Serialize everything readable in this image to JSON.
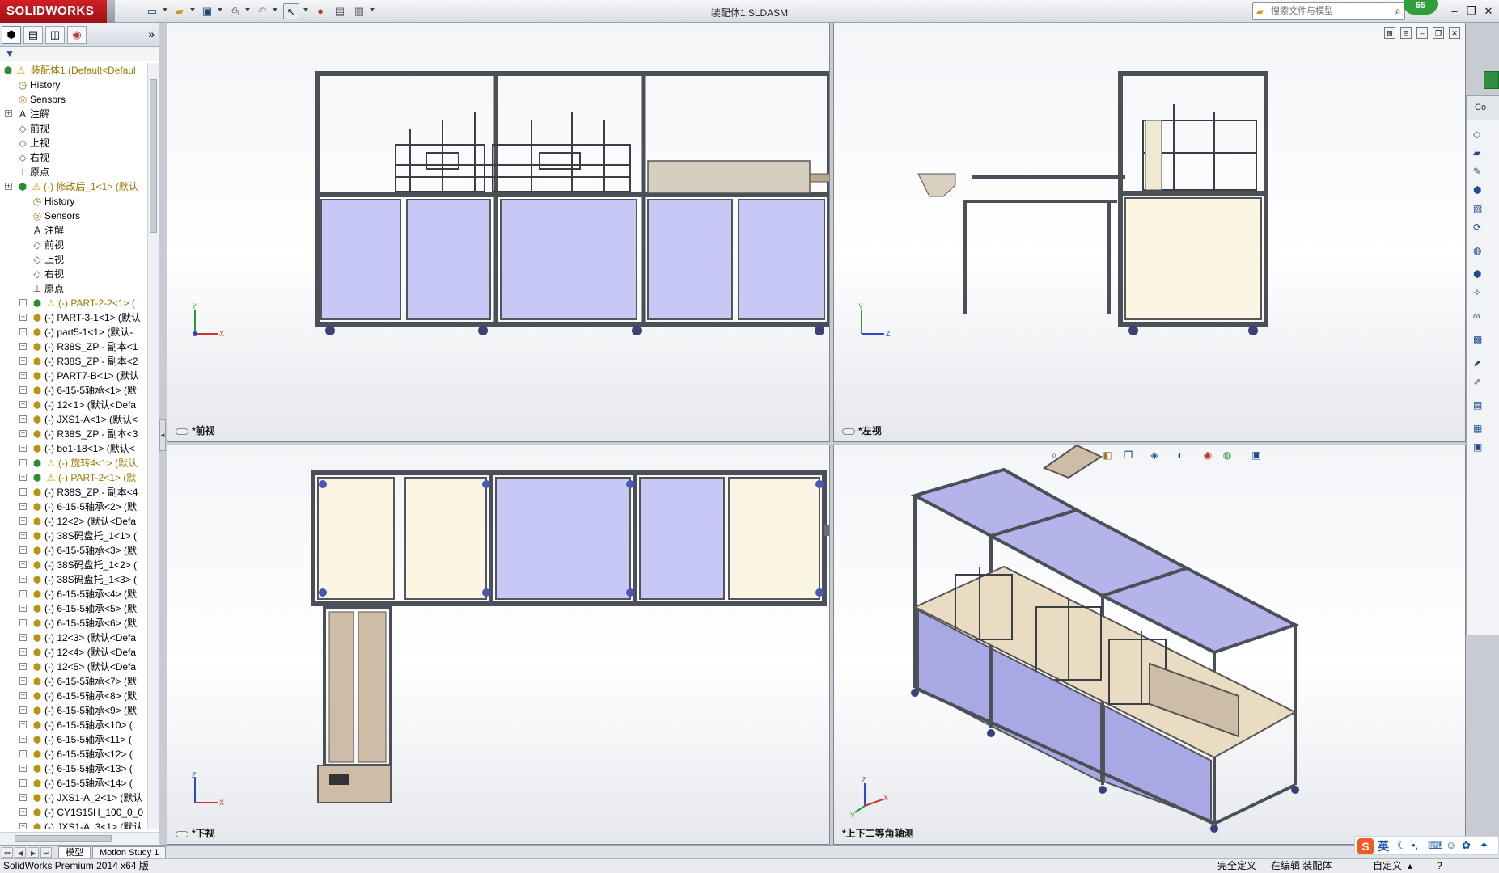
{
  "app": {
    "logo_text": "SOLIDWORKS",
    "document_title": "装配体1.SLDASM",
    "search_placeholder": "搜索文件与模型",
    "badge_count": "65"
  },
  "feature_tree": {
    "root_label": "装配体1  (Default<Defaul",
    "items": [
      {
        "label": "History",
        "icon": "history-icon",
        "indent": 1
      },
      {
        "label": "Sensors",
        "icon": "sensors-icon",
        "indent": 1
      },
      {
        "label": "注解",
        "icon": "annotations-icon",
        "indent": 1,
        "expandable": true
      },
      {
        "label": "前视",
        "icon": "plane-icon",
        "indent": 1
      },
      {
        "label": "上视",
        "icon": "plane-icon",
        "indent": 1
      },
      {
        "label": "右视",
        "icon": "plane-icon",
        "indent": 1
      },
      {
        "label": "原点",
        "icon": "origin-icon",
        "indent": 1
      },
      {
        "label": "(-) 修改后_1<1> (默认",
        "icon": "subassembly-icon",
        "indent": 1,
        "expandable": true,
        "warning": true
      },
      {
        "label": "History",
        "icon": "history-icon",
        "indent": 2
      },
      {
        "label": "Sensors",
        "icon": "sensors-icon",
        "indent": 2
      },
      {
        "label": "注解",
        "icon": "annotations-icon",
        "indent": 2
      },
      {
        "label": "前视",
        "icon": "plane-icon",
        "indent": 2
      },
      {
        "label": "上视",
        "icon": "plane-icon",
        "indent": 2
      },
      {
        "label": "右视",
        "icon": "plane-icon",
        "indent": 2
      },
      {
        "label": "原点",
        "icon": "origin-icon",
        "indent": 2
      },
      {
        "label": "(-) PART-2-2<1> (",
        "icon": "subassembly-icon",
        "indent": 2,
        "expandable": true,
        "warning": true
      },
      {
        "label": "(-) PART-3-1<1> (默认",
        "icon": "part-icon",
        "indent": 2,
        "expandable": true
      },
      {
        "label": "(-) part5-1<1> (默认-",
        "icon": "part-icon",
        "indent": 2,
        "expandable": true
      },
      {
        "label": "(-) R38S_ZP - 副本<1",
        "icon": "part-icon",
        "indent": 2,
        "expandable": true
      },
      {
        "label": "(-) R38S_ZP - 副本<2",
        "icon": "part-icon",
        "indent": 2,
        "expandable": true
      },
      {
        "label": "(-) PART7-B<1> (默认",
        "icon": "part-icon",
        "indent": 2,
        "expandable": true
      },
      {
        "label": "(-) 6-15-5轴承<1> (默",
        "icon": "part-icon",
        "indent": 2,
        "expandable": true
      },
      {
        "label": "(-) 12<1> (默认<Defa",
        "icon": "part-icon",
        "indent": 2,
        "expandable": true
      },
      {
        "label": "(-) JXS1-A<1> (默认<",
        "icon": "part-icon",
        "indent": 2,
        "expandable": true
      },
      {
        "label": "(-) R38S_ZP - 副本<3",
        "icon": "part-icon",
        "indent": 2,
        "expandable": true
      },
      {
        "label": "(-) be1-18<1> (默认<",
        "icon": "part-icon",
        "indent": 2,
        "expandable": true
      },
      {
        "label": "(-) 旋转4<1> (默认",
        "icon": "subassembly-icon",
        "indent": 2,
        "expandable": true,
        "warning": true
      },
      {
        "label": "(-) PART-2<1> (默",
        "icon": "subassembly-icon",
        "indent": 2,
        "expandable": true,
        "warning": true
      },
      {
        "label": "(-) R38S_ZP - 副本<4",
        "icon": "part-icon",
        "indent": 2,
        "expandable": true
      },
      {
        "label": "(-) 6-15-5轴承<2> (默",
        "icon": "part-icon",
        "indent": 2,
        "expandable": true
      },
      {
        "label": "(-) 12<2> (默认<Defa",
        "icon": "part-icon",
        "indent": 2,
        "expandable": true
      },
      {
        "label": "(-) 38S码盘托_1<1> (",
        "icon": "part-icon",
        "indent": 2,
        "expandable": true
      },
      {
        "label": "(-) 6-15-5轴承<3> (默",
        "icon": "part-icon",
        "indent": 2,
        "expandable": true
      },
      {
        "label": "(-) 38S码盘托_1<2> (",
        "icon": "part-icon",
        "indent": 2,
        "expandable": true
      },
      {
        "label": "(-) 38S码盘托_1<3> (",
        "icon": "part-icon",
        "indent": 2,
        "expandable": true
      },
      {
        "label": "(-) 6-15-5轴承<4> (默",
        "icon": "part-icon",
        "indent": 2,
        "expandable": true
      },
      {
        "label": "(-) 6-15-5轴承<5> (默",
        "icon": "part-icon",
        "indent": 2,
        "expandable": true
      },
      {
        "label": "(-) 6-15-5轴承<6> (默",
        "icon": "part-icon",
        "indent": 2,
        "expandable": true
      },
      {
        "label": "(-) 12<3> (默认<Defa",
        "icon": "part-icon",
        "indent": 2,
        "expandable": true
      },
      {
        "label": "(-) 12<4> (默认<Defa",
        "icon": "part-icon",
        "indent": 2,
        "expandable": true
      },
      {
        "label": "(-) 12<5> (默认<Defa",
        "icon": "part-icon",
        "indent": 2,
        "expandable": true
      },
      {
        "label": "(-) 6-15-5轴承<7> (默",
        "icon": "part-icon",
        "indent": 2,
        "expandable": true
      },
      {
        "label": "(-) 6-15-5轴承<8> (默",
        "icon": "part-icon",
        "indent": 2,
        "expandable": true
      },
      {
        "label": "(-) 6-15-5轴承<9> (默",
        "icon": "part-icon",
        "indent": 2,
        "expandable": true
      },
      {
        "label": "(-) 6-15-5轴承<10> (",
        "icon": "part-icon",
        "indent": 2,
        "expandable": true
      },
      {
        "label": "(-) 6-15-5轴承<11> (",
        "icon": "part-icon",
        "indent": 2,
        "expandable": true
      },
      {
        "label": "(-) 6-15-5轴承<12> (",
        "icon": "part-icon",
        "indent": 2,
        "expandable": true
      },
      {
        "label": "(-) 6-15-5轴承<13> (",
        "icon": "part-icon",
        "indent": 2,
        "expandable": true
      },
      {
        "label": "(-) 6-15-5轴承<14> (",
        "icon": "part-icon",
        "indent": 2,
        "expandable": true
      },
      {
        "label": "(-) JXS1-A_2<1> (默认",
        "icon": "part-icon",
        "indent": 2,
        "expandable": true
      },
      {
        "label": "(-) CY1S15H_100_0_0",
        "icon": "part-icon",
        "indent": 2,
        "expandable": true
      },
      {
        "label": "(-) JXS1-A_3<1> (默认",
        "icon": "part-icon",
        "indent": 2,
        "expandable": true
      }
    ]
  },
  "viewports": {
    "front": {
      "label": "*前视",
      "triad_axes": [
        "Y",
        "X"
      ]
    },
    "left": {
      "label": "*左视",
      "triad_axes": [
        "Y",
        "Z"
      ]
    },
    "bottom": {
      "label": "*下视",
      "triad_axes": [
        "Z",
        "X"
      ]
    },
    "iso": {
      "label": "*上下二等角轴测",
      "triad_axes": [
        "Z",
        "X",
        "Y"
      ]
    }
  },
  "doc_tabs": {
    "model": "模型",
    "motion": "Motion Study 1"
  },
  "status": {
    "product": "SolidWorks Premium 2014 x64 版",
    "defined": "完全定义",
    "editing": "在编辑 装配体",
    "units": "自定义"
  },
  "taskpane": {
    "header": "Co"
  },
  "ime": {
    "lang": "英"
  },
  "colors": {
    "frame": "#4b4f57",
    "panel_lavender": "#c8c8f6",
    "panel_cream": "#fbf6e4",
    "solidworks_red": "#c81c23"
  }
}
